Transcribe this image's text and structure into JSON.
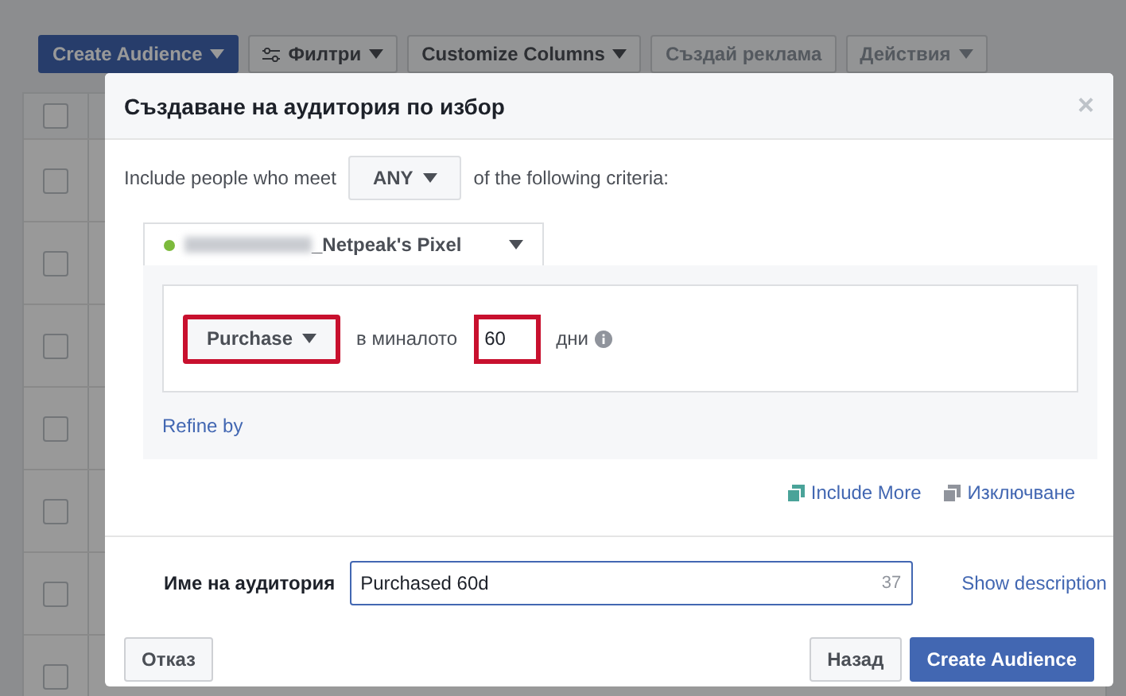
{
  "toolbar": {
    "buttons": [
      {
        "label": "Create Audience",
        "kind": "primary",
        "caret": true,
        "disabled": false
      },
      {
        "label": "Филтри",
        "kind": "filter",
        "caret": true,
        "disabled": false
      },
      {
        "label": "Customize Columns",
        "kind": "plain",
        "caret": true,
        "disabled": false
      },
      {
        "label": "Създай реклама",
        "kind": "plain",
        "caret": false,
        "disabled": true
      },
      {
        "label": "Действия",
        "kind": "plain",
        "caret": true,
        "disabled": true
      }
    ]
  },
  "table": {
    "header": {
      "checked": false
    },
    "rows": [
      {
        "checked": false
      },
      {
        "checked": false
      },
      {
        "checked": false
      },
      {
        "checked": false
      },
      {
        "checked": false
      },
      {
        "checked": false
      },
      {
        "checked": false
      }
    ]
  },
  "dialog": {
    "title": "Създаване на аудитория по избор",
    "close": "×",
    "match": {
      "before": "Include people who meet",
      "value": "ANY",
      "after": "of the following criteria:"
    },
    "pixel": {
      "name": "_Netpeak's Pixel",
      "active": true,
      "redacted": true
    },
    "rule": {
      "event": {
        "value": "Purchase",
        "highlighted": true
      },
      "in_the_past": "в миналото",
      "days": {
        "value": "60",
        "highlighted": true
      },
      "unit": "дни"
    },
    "refine": "Refine by",
    "links": [
      {
        "label": "Include More",
        "kind": "include"
      },
      {
        "label": "Изключване",
        "kind": "exclude"
      }
    ],
    "name_field": {
      "label": "Име на аудитория",
      "value": "Purchased 60d",
      "counter": "37"
    },
    "show_description": "Show description",
    "buttons": [
      {
        "label": "Отказ",
        "kind": "plain"
      },
      {
        "label": "Назад",
        "kind": "plain"
      },
      {
        "label": "Create Audience",
        "kind": "primary"
      }
    ]
  }
}
